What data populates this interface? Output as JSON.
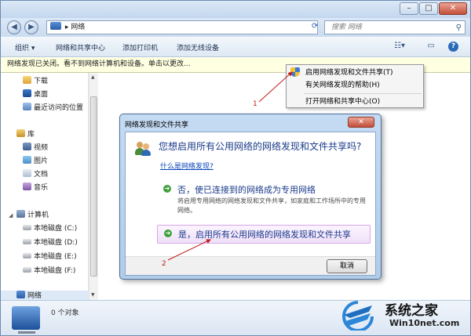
{
  "window": {
    "address_path": "网络",
    "search_placeholder": "搜索 网络",
    "controls": {
      "minimize": "–",
      "maximize": "□",
      "close": "✕"
    }
  },
  "toolbar": {
    "organize": "组织",
    "network_sharing_center": "网络和共享中心",
    "add_printer": "添加打印机",
    "add_wireless_device": "添加无线设备"
  },
  "infobar": {
    "text": "网络发现已关闭。看不到网络计算机和设备。单击以更改..."
  },
  "sidebar": {
    "favorites": [
      "下载",
      "桌面",
      "最近访问的位置"
    ],
    "libraries_label": "库",
    "libraries": [
      "视频",
      "图片",
      "文档",
      "音乐"
    ],
    "computer_label": "计算机",
    "drives": [
      "本地磁盘 (C:)",
      "本地磁盘 (D:)",
      "本地磁盘 (E:)",
      "本地磁盘 (F:)"
    ],
    "network_label": "网络"
  },
  "details": {
    "object_count": "0 个对象"
  },
  "context_menu": {
    "items": [
      "启用网络发现和文件共享(T)",
      "有关网络发现的帮助(H)",
      "打开网络和共享中心(O)"
    ]
  },
  "dialog": {
    "title": "网络发现和文件共享",
    "question": "您想启用所有公用网络的网络发现和文件共享吗?",
    "link": "什么是网络发现?",
    "option_no_title": "否，使已连接到的网络成为专用网络",
    "option_no_desc": "将启用专用网络的网络发现和文件共享，如家庭和工作场所中的专用网络。",
    "option_yes_title": "是，启用所有公用网络的网络发现和文件共享",
    "cancel": "取消"
  },
  "annotations": {
    "step1": "1",
    "step2": "2"
  },
  "watermark": {
    "name": "系统之家",
    "url": "Win10net.com"
  },
  "colors": {
    "accent": "#2a5ea8",
    "annotation": "#c21a1a",
    "infobar": "#ffffe1"
  }
}
